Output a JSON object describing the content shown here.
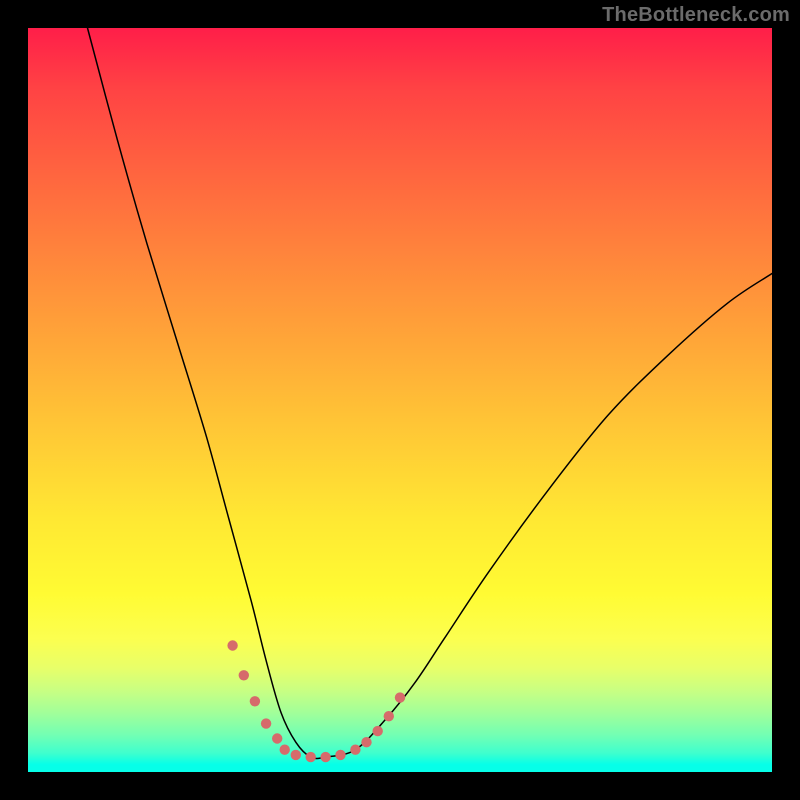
{
  "attribution": "TheBottleneck.com",
  "chart_data": {
    "type": "line",
    "title": "",
    "xlabel": "",
    "ylabel": "",
    "xlim": [
      0,
      100
    ],
    "ylim": [
      0,
      100
    ],
    "background_gradient_stops": [
      {
        "pos": 0,
        "color": "#ff1e49"
      },
      {
        "pos": 8,
        "color": "#ff4244"
      },
      {
        "pos": 20,
        "color": "#ff663f"
      },
      {
        "pos": 35,
        "color": "#ff923a"
      },
      {
        "pos": 52,
        "color": "#ffc236"
      },
      {
        "pos": 66,
        "color": "#ffe833"
      },
      {
        "pos": 76,
        "color": "#fffb33"
      },
      {
        "pos": 82,
        "color": "#fcff4f"
      },
      {
        "pos": 86,
        "color": "#e8ff69"
      },
      {
        "pos": 89,
        "color": "#c9ff82"
      },
      {
        "pos": 92,
        "color": "#a2ff99"
      },
      {
        "pos": 95,
        "color": "#73ffb3"
      },
      {
        "pos": 97.5,
        "color": "#3effce"
      },
      {
        "pos": 100,
        "color": "#06ffe8"
      }
    ],
    "series": [
      {
        "name": "bottleneck-curve",
        "stroke": "#000000",
        "stroke_width": 1.5,
        "x": [
          8,
          12,
          16,
          20,
          24,
          27,
          30,
          32,
          34,
          36,
          38,
          40,
          44,
          48,
          52,
          56,
          62,
          70,
          78,
          86,
          94,
          100
        ],
        "y": [
          100,
          85,
          71,
          58,
          45,
          34,
          23,
          15,
          8,
          4,
          2,
          2,
          3,
          7,
          12,
          18,
          27,
          38,
          48,
          56,
          63,
          67
        ]
      },
      {
        "name": "highlight-dots",
        "stroke": "#d66b6b",
        "marker": "circle",
        "marker_radius": 3.5,
        "x": [
          27.5,
          29.0,
          30.5,
          32.0,
          33.5,
          34.5,
          36.0,
          38.0,
          40.0,
          42.0,
          44.0,
          45.5,
          47.0,
          48.5,
          50.0
        ],
        "y": [
          17.0,
          13.0,
          9.5,
          6.5,
          4.5,
          3.0,
          2.3,
          2.0,
          2.0,
          2.3,
          3.0,
          4.0,
          5.5,
          7.5,
          10.0
        ]
      }
    ]
  }
}
